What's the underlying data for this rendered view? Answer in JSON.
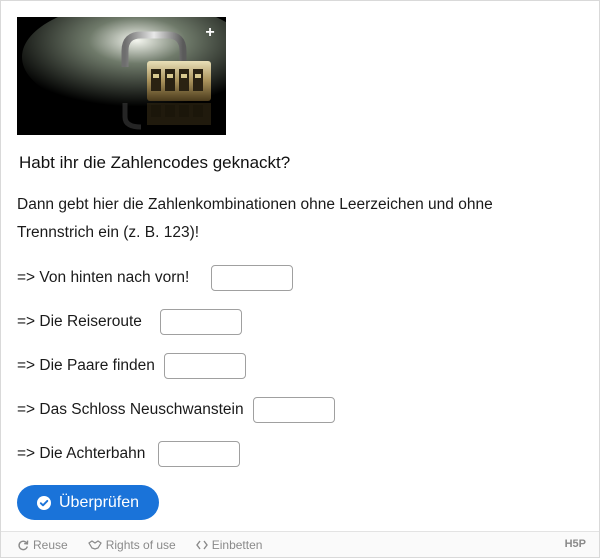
{
  "image": {
    "expand_icon": "plus-icon"
  },
  "title": "Habt ihr die Zahlencodes geknackt?",
  "intro": "Dann gebt hier die Zahlenkombinationen ohne Leerzeichen und ohne Trennstrich ein (z. B. 123)!",
  "rows": [
    {
      "label": "=> Von hinten nach vorn!",
      "value": ""
    },
    {
      "label": "=> Die Reiseroute",
      "value": ""
    },
    {
      "label": "=> Die Paare finden",
      "value": ""
    },
    {
      "label": "=> Das Schloss Neuschwanstein",
      "value": ""
    },
    {
      "label": "=> Die Achterbahn",
      "value": ""
    }
  ],
  "check_button": {
    "label": "Überprüfen",
    "icon": "check-circle-icon"
  },
  "footer": {
    "reuse": "Reuse",
    "rights": "Rights of use",
    "embed": "Einbetten",
    "brand": "H5P"
  },
  "colors": {
    "accent": "#1a73d9",
    "footer_text": "#8a8a8a"
  }
}
